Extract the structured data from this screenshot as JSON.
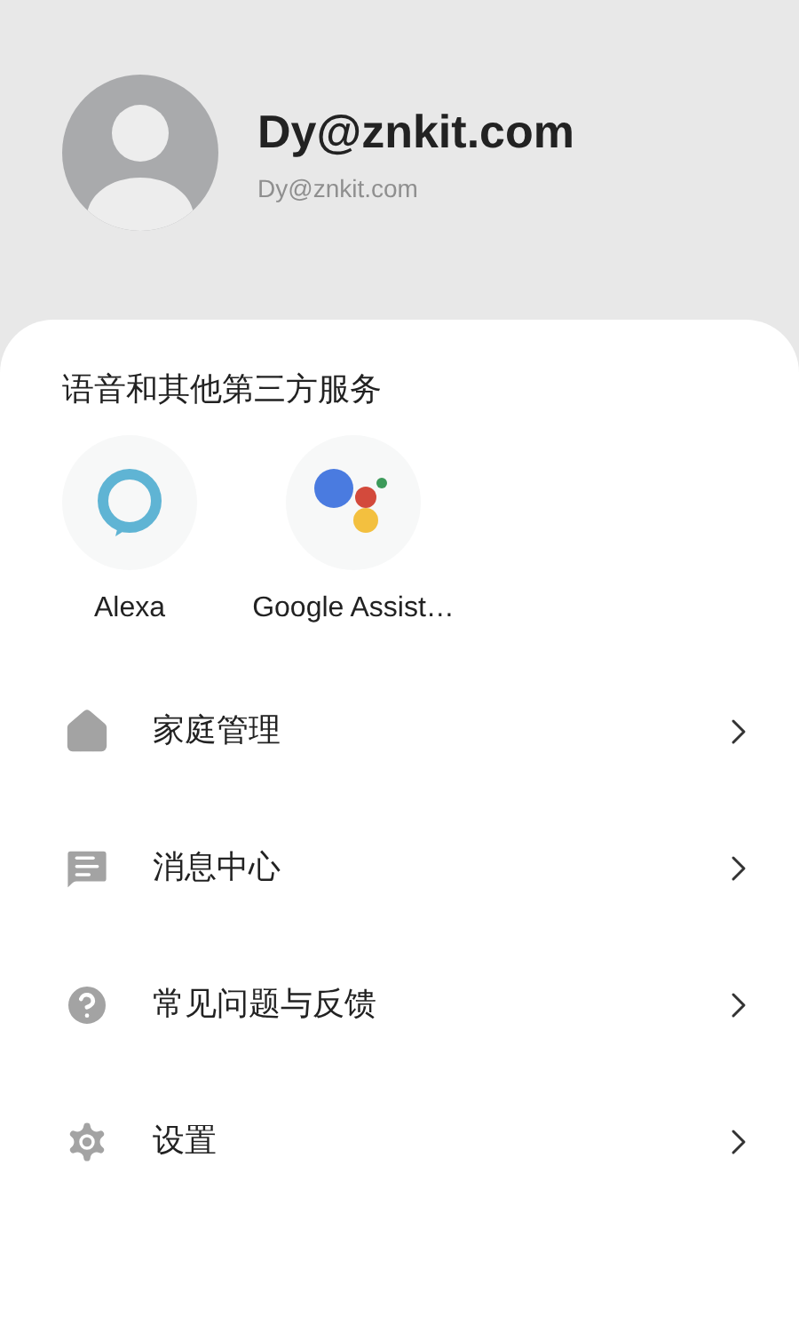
{
  "profile": {
    "name": "Dy@znkit.com",
    "email": "Dy@znkit.com"
  },
  "services": {
    "title": "语音和其他第三方服务",
    "items": [
      {
        "kind": "alexa",
        "label": "Alexa"
      },
      {
        "kind": "google",
        "label": "Google Assist…"
      }
    ]
  },
  "menu": [
    {
      "kind": "home",
      "label": "家庭管理"
    },
    {
      "kind": "message",
      "label": "消息中心"
    },
    {
      "kind": "help",
      "label": "常见问题与反馈"
    },
    {
      "kind": "settings",
      "label": "设置"
    }
  ]
}
